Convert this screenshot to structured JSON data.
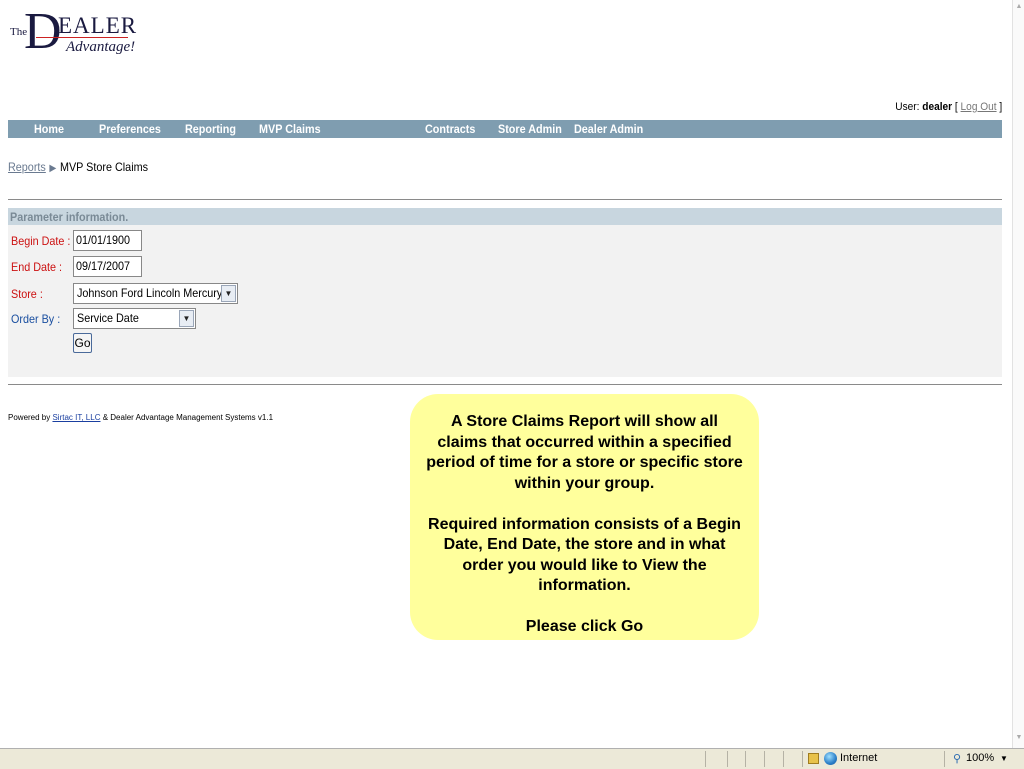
{
  "logo": {
    "the": "The",
    "d": "D",
    "ealer": "EALER",
    "advantage": "Advantage!"
  },
  "user": {
    "prefix": "User: ",
    "name": "dealer",
    "open_bracket": " [ ",
    "logout": "Log Out",
    "close_bracket": " ]"
  },
  "nav": {
    "items": [
      "Home",
      "Preferences",
      "Reporting",
      "MVP Claims",
      "Contracts",
      "Store Admin",
      "Dealer Admin"
    ]
  },
  "breadcrumb": {
    "parent": "Reports",
    "separator": "▶",
    "current": "MVP Store Claims"
  },
  "params": {
    "header": "Parameter information.",
    "begin_label": "Begin Date :",
    "begin_value": "01/01/1900",
    "end_label": "End Date :",
    "end_value": "09/17/2007",
    "store_label": "Store :",
    "store_value": "Johnson Ford Lincoln Mercury",
    "order_label": "Order By :",
    "order_value": "Service Date",
    "go_label": "Go"
  },
  "footer": {
    "prefix": "Powered by ",
    "link": "Sirtac IT, LLC",
    "suffix": " & Dealer Advantage Management Systems v1.1"
  },
  "callout": {
    "p1": "A Store Claims Report will show all claims that occurred within a specified period of time for a store or specific store within your group.",
    "p2": "Required information consists of a Begin Date, End Date, the store and in what order you would like to View the information.",
    "p3": "Please click Go"
  },
  "status": {
    "zone": "Internet",
    "zoom": "100%"
  },
  "icons": {
    "select_arrow": "chevron-down-icon",
    "breadcrumb_arrow": "triangle-right-icon",
    "zone": "globe-icon",
    "zoom": "magnifier-icon"
  }
}
